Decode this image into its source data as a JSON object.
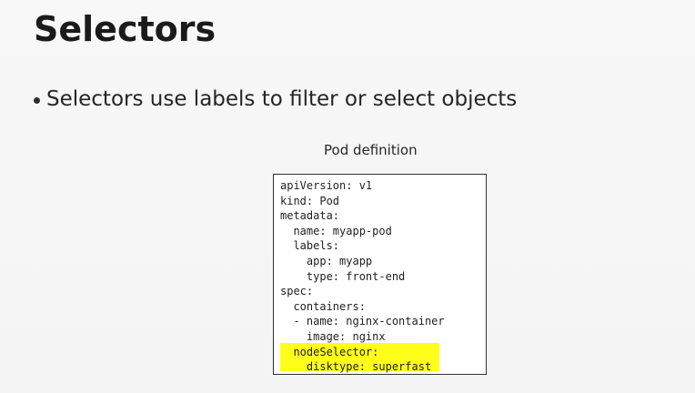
{
  "slide": {
    "title": "Selectors",
    "bullet": "Selectors use labels to filter or select objects",
    "caption": "Pod definition",
    "code_lines": [
      "apiVersion: v1",
      "kind: Pod",
      "metadata:",
      "  name: myapp-pod",
      "  labels:",
      "    app: myapp",
      "    type: front-end",
      "spec:",
      "  containers:",
      "  - name: nginx-container",
      "    image: nginx",
      "  nodeSelector:",
      "    disktype: superfast"
    ],
    "highlight_color": "#ffff1a"
  }
}
